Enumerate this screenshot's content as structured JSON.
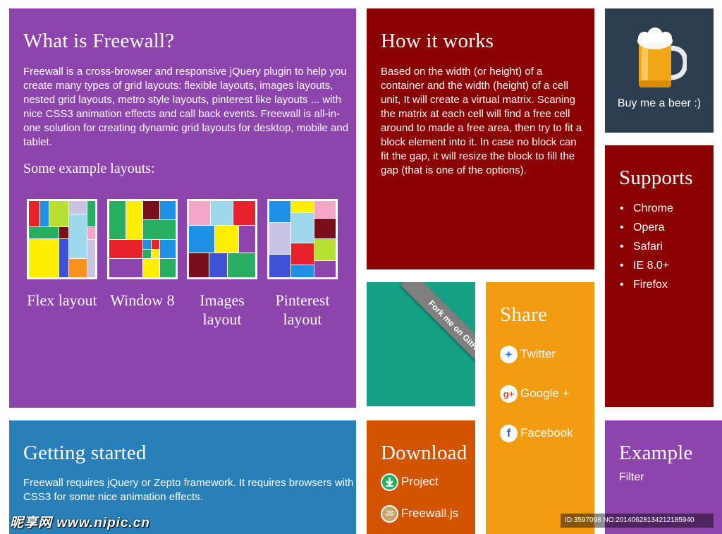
{
  "what": {
    "title": "What is Freewall?",
    "intro": "Freewall is a cross-browser and responsive jQuery plugin to help you create many types of grid layouts: flexible layouts, images layouts, nested grid layouts, metro style layouts, pinterest like layouts ... with nice CSS3 animation effects and call back events. Freewall is all-in-one solution for creating dynamic grid layouts for desktop, mobile and tablet.",
    "examples_title": "Some example layouts:",
    "layouts": [
      {
        "label": "Flex layout"
      },
      {
        "label": "Window 8"
      },
      {
        "label": "Images layout"
      },
      {
        "label": "Pinterest layout"
      }
    ]
  },
  "how": {
    "title": "How it works",
    "description": "Based on the width (or height) of a container and the width (height) of a cell unit, It will create a virtual matrix. Scaning the matrix at each cell will find a free cell around to made a free area, then try to fit a block element into it. In case no block can fit the gap, it will resize the block to fill the gap (that is one of the options)."
  },
  "beer": {
    "caption": "Buy me a beer :)",
    "icon": "beer-mug-icon"
  },
  "supports": {
    "title": "Supports",
    "items": [
      "Chrome",
      "Opera",
      "Safari",
      "IE 8.0+",
      "Firefox"
    ]
  },
  "github": {
    "ribbon": "Fork me on GitHub"
  },
  "share": {
    "title": "Share",
    "items": [
      {
        "label": "Twitter",
        "icon": "twitter-icon"
      },
      {
        "label": "Google +",
        "icon": "google-plus-icon"
      },
      {
        "label": "Facebook",
        "icon": "facebook-icon"
      }
    ]
  },
  "getting_started": {
    "title": "Getting started",
    "description": "Freewall requires jQuery or Zepto framework. It requires browsers with CSS3 for some nice animation effects."
  },
  "download": {
    "title": "Download",
    "items": [
      {
        "label": "Project",
        "icon": "download-icon"
      },
      {
        "label": "Freewall.js",
        "icon": "js-icon"
      }
    ]
  },
  "example": {
    "title": "Example",
    "sub": "Filter"
  },
  "watermark": {
    "left": "昵享网 www.nipic.cn",
    "right": "ID:3597098 NO:20140628134212185940"
  },
  "colors": {
    "purple": "#8e44ad",
    "dark_red": "#8b0000",
    "navy": "#2c3e50",
    "teal": "#16a085",
    "orange": "#f39c12",
    "blue": "#2980b9",
    "pumpkin": "#d35400",
    "mosaic_red": "#e8222c",
    "mosaic_blue": "#1e90e6",
    "mosaic_green": "#27ae60",
    "mosaic_yellow": "#ffee00",
    "mosaic_maroon": "#7a0f1c",
    "mosaic_pink": "#f4a6c9",
    "mosaic_lightblue": "#9fd8ec",
    "mosaic_violet": "#8e44ad",
    "mosaic_lime": "#b7e033",
    "mosaic_orange": "#f7931e",
    "mosaic_lavender": "#c9c3e6",
    "mosaic_indigo": "#3f51d6"
  }
}
